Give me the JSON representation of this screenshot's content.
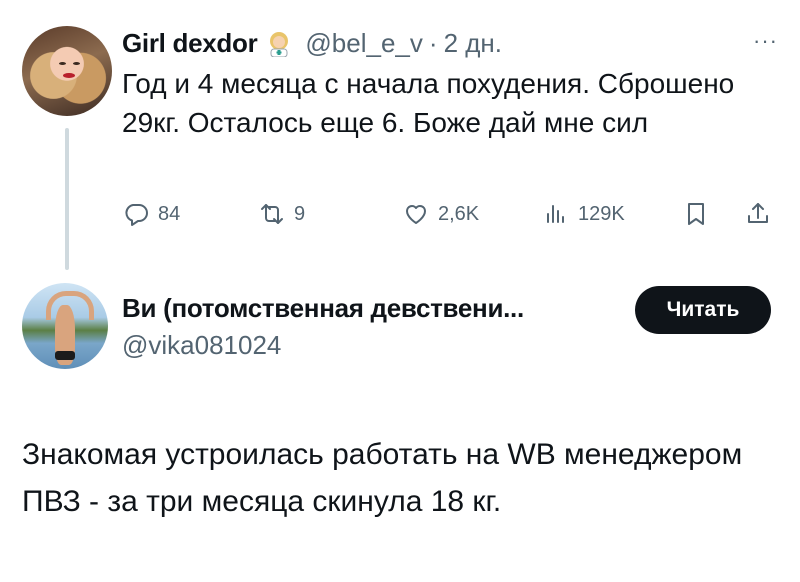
{
  "tweet1": {
    "display_name": "Girl dexdor",
    "emoji_icon": "woman-health-worker-emoji",
    "handle": "@bel_e_v",
    "separator": "·",
    "time_ago": "2 дн.",
    "more_label": "···",
    "text": "Год и 4 месяца с начала похудения. Сброшено 29кг. Осталось еще 6. Боже дай мне сил",
    "actions": {
      "reply_count": "84",
      "retweet_count": "9",
      "like_count": "2,6K",
      "views_count": "129K"
    }
  },
  "tweet2": {
    "display_name": "Ви (потомственная девствени...",
    "handle": "@vika081024",
    "follow_button_label": "Читать",
    "text": "Знакомая устроилась работать на WB менеджером ПВЗ - за три месяца скинула 18 кг."
  },
  "colors": {
    "text_primary": "#0f1419",
    "text_secondary": "#536471",
    "thread_line": "#cfd9de",
    "button_bg": "#0f1419"
  }
}
